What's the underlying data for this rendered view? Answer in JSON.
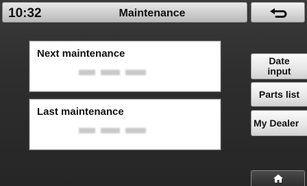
{
  "status": {
    "time": "10:32"
  },
  "header": {
    "title": "Maintenance"
  },
  "nav": {
    "back_icon": "back-arrow-icon",
    "home_icon": "home-icon"
  },
  "cards": [
    {
      "label": "Next maintenance"
    },
    {
      "label": "Last maintenance"
    }
  ],
  "side_buttons": {
    "date_input": "Date input",
    "parts_list": "Parts list",
    "my_dealer": "My Dealer"
  }
}
